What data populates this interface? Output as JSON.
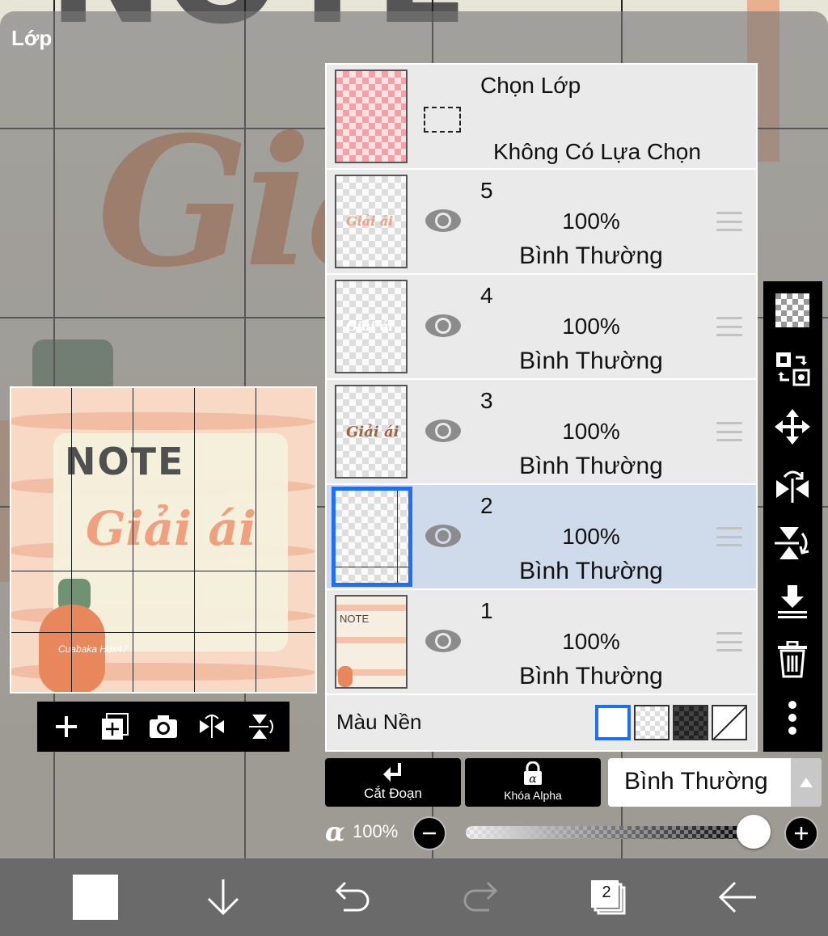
{
  "panel": {
    "title": "Lớp"
  },
  "preview": {
    "note_text": "NOTE",
    "script_text": "Giải ái",
    "signature": "Cuabaka Hdx47"
  },
  "preview_toolbar": {
    "icons": [
      "plus-icon",
      "add-layer-icon",
      "camera-icon",
      "flip-horizontal-icon",
      "flip-vertical-icon"
    ]
  },
  "selection_layer": {
    "title": "Chọn Lớp",
    "status": "Không Có Lựa Chọn"
  },
  "layers": [
    {
      "number": "5",
      "opacity": "100%",
      "blend": "Bình Thường",
      "thumb_text": "Giải ái",
      "thumb_color": "#f0a07e"
    },
    {
      "number": "4",
      "opacity": "100%",
      "blend": "Bình Thường",
      "thumb_text": "Giải ái",
      "thumb_color": "#ffffff"
    },
    {
      "number": "3",
      "opacity": "100%",
      "blend": "Bình Thường",
      "thumb_text": "Giải ái",
      "thumb_color": "#a0613f"
    },
    {
      "number": "2",
      "opacity": "100%",
      "blend": "Bình Thường",
      "selected": true
    },
    {
      "number": "1",
      "opacity": "100%",
      "blend": "Bình Thường",
      "thumb_text": "NOTE"
    }
  ],
  "background": {
    "label": "Màu Nền",
    "options": [
      "white",
      "checker",
      "dark-checker",
      "none"
    ],
    "selected": "white"
  },
  "right_toolbar": {
    "icons": [
      "checkerboard-icon",
      "transfer-icon",
      "move-icon",
      "flip-horizontal-icon",
      "flip-vertical-icon",
      "merge-down-icon",
      "trash-icon",
      "more-icon"
    ]
  },
  "controls": {
    "clipping_label": "Cắt Đoạn",
    "alpha_lock_label": "Khóa Alpha",
    "blend_mode": "Bình Thường",
    "alpha_symbol": "α",
    "alpha_value": "100%",
    "opacity_fraction": 1.0
  },
  "bottom_bar": {
    "layer_count": "2",
    "icons": [
      "color-swatch",
      "arrow-down-icon",
      "undo-icon",
      "redo-icon",
      "layers-icon",
      "back-arrow-icon"
    ]
  },
  "colors": {
    "accent": "#1f6ff0",
    "selected_row": "#cfdaeb",
    "panel_bg": "#eaeaea"
  }
}
